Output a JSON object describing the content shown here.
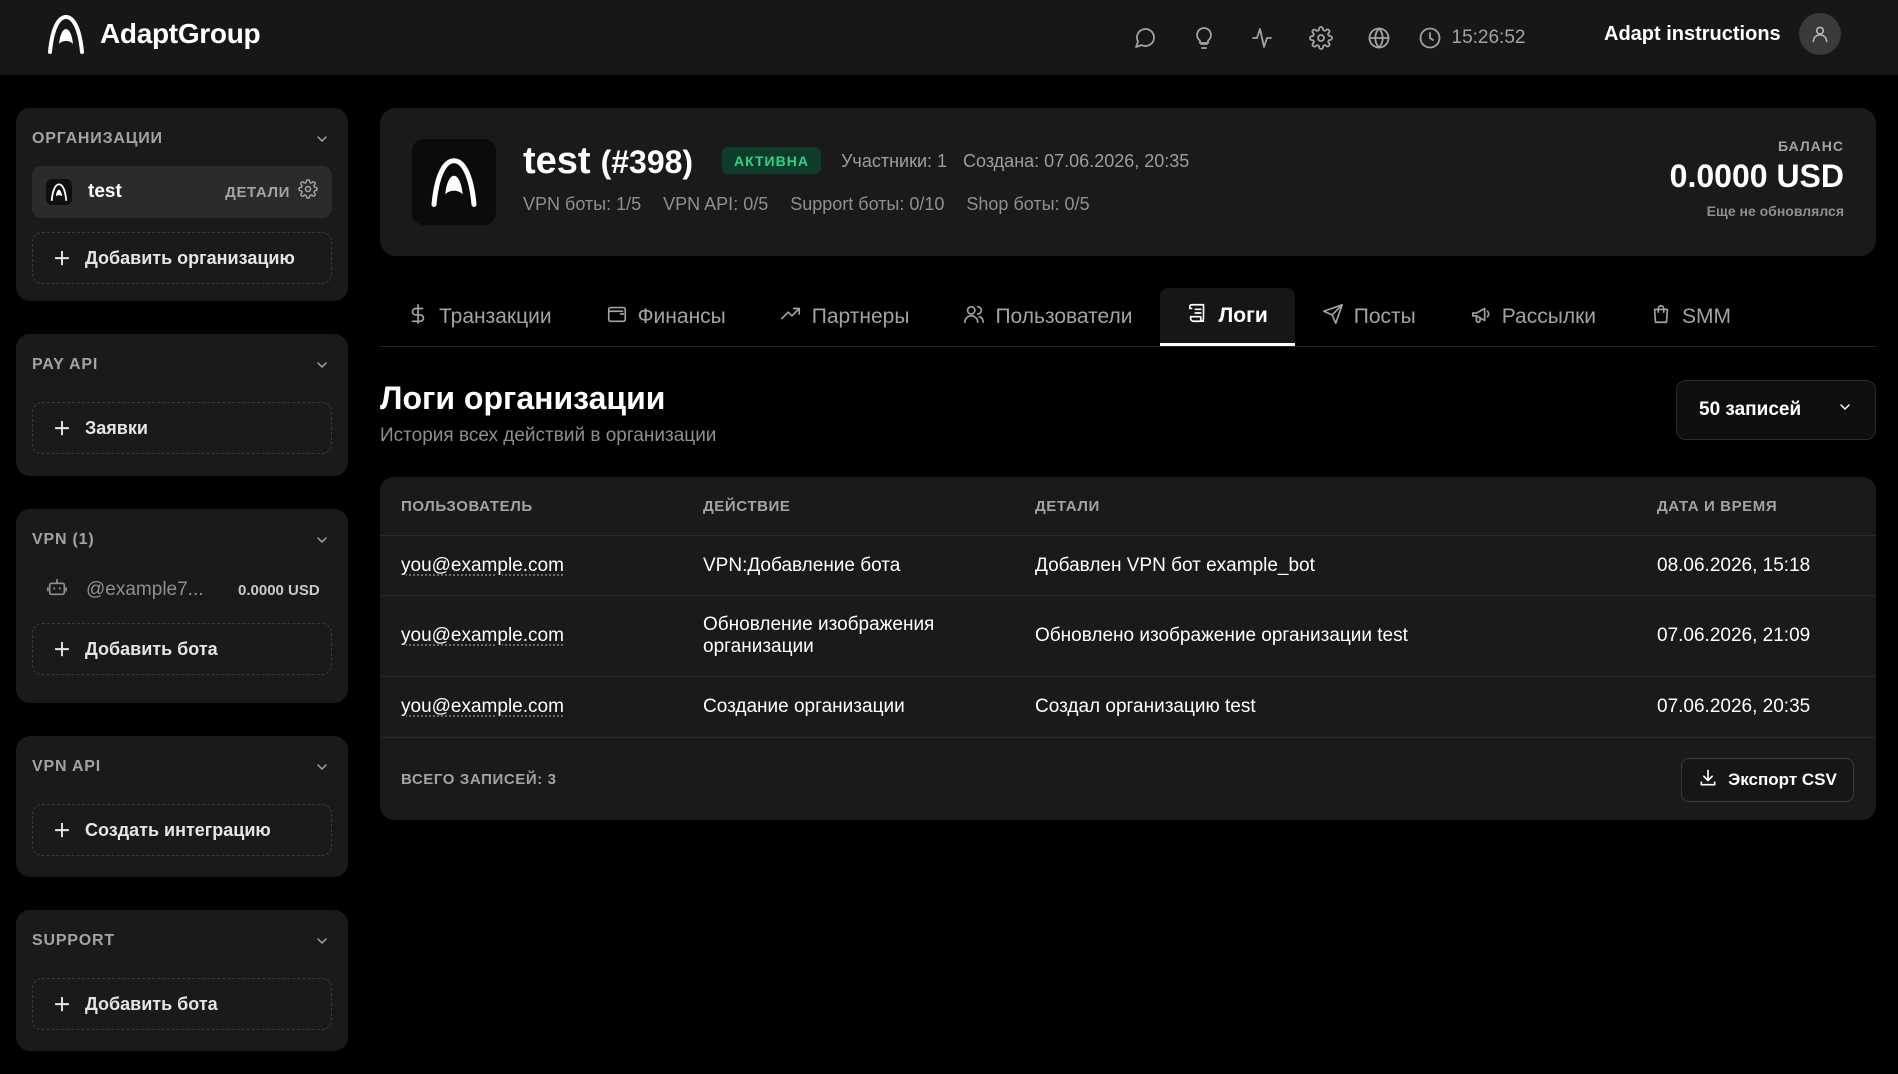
{
  "header": {
    "brand": "AdaptGroup",
    "time": "15:26:52",
    "user_label": "Adapt instructions",
    "icons": [
      "chat-icon",
      "lightbulb-icon",
      "activity-icon",
      "settings-icon",
      "globe-icon",
      "clock-icon",
      "user-icon"
    ]
  },
  "sidebar": {
    "orgs": {
      "title": "ОРГАНИЗАЦИИ",
      "org_name": "test",
      "details_label": "ДЕТАЛИ",
      "add_label": "Добавить организацию"
    },
    "pay_api": {
      "title": "PAY API",
      "add_label": "Заявки"
    },
    "vpn": {
      "title": "VPN (1)",
      "bot_name": "@example7...",
      "bot_balance": "0.0000 USD",
      "add_label": "Добавить бота"
    },
    "vpn_api": {
      "title": "VPN API",
      "add_label": "Создать интеграцию"
    },
    "support": {
      "title": "SUPPORT",
      "add_label": "Добавить бота"
    }
  },
  "org": {
    "name": "test",
    "id": "(#398)",
    "status": "АКТИВНА",
    "members": "Участники: 1",
    "created": "Создана: 07.06.2026, 20:35",
    "limits": [
      "VPN боты: 1/5",
      "VPN API: 0/5",
      "Support боты: 0/10",
      "Shop боты: 0/5"
    ],
    "balance_label": "БАЛАНС",
    "balance_value": "0.0000 USD",
    "balance_note": "Еще не обновлялся"
  },
  "tabs": [
    {
      "label": "Транзакции",
      "icon": "dollar-icon"
    },
    {
      "label": "Финансы",
      "icon": "wallet-icon"
    },
    {
      "label": "Партнеры",
      "icon": "trending-up-icon"
    },
    {
      "label": "Пользователи",
      "icon": "users-icon"
    },
    {
      "label": "Логи",
      "icon": "scroll-icon",
      "active": true
    },
    {
      "label": "Посты",
      "icon": "send-icon"
    },
    {
      "label": "Рассылки",
      "icon": "megaphone-icon"
    },
    {
      "label": "SMM",
      "icon": "shopping-bag-icon"
    }
  ],
  "logs": {
    "title": "Логи организации",
    "subtitle": "История всех действий в организации",
    "records_select": "50 записей",
    "columns": [
      "ПОЛЬЗОВАТЕЛЬ",
      "ДЕЙСТВИЕ",
      "ДЕТАЛИ",
      "ДАТА И ВРЕМЯ"
    ],
    "rows": [
      {
        "user": "you@example.com",
        "action": "VPN:Добавление бота",
        "details": "Добавлен VPN бот example_bot",
        "datetime": "08.06.2026, 15:18"
      },
      {
        "user": "you@example.com",
        "action": "Обновление изображения организации",
        "details": "Обновлено изображение организации test",
        "datetime": "07.06.2026, 21:09"
      },
      {
        "user": "you@example.com",
        "action": "Создание организации",
        "details": "Создал организацию test",
        "datetime": "07.06.2026, 20:35"
      }
    ],
    "total": "ВСЕГО ЗАПИСЕЙ: 3",
    "export_label": "Экспорт CSV"
  },
  "colors": {
    "background": "#000000",
    "panel": "#1a1a1a",
    "status_green": "#2fd48c"
  }
}
